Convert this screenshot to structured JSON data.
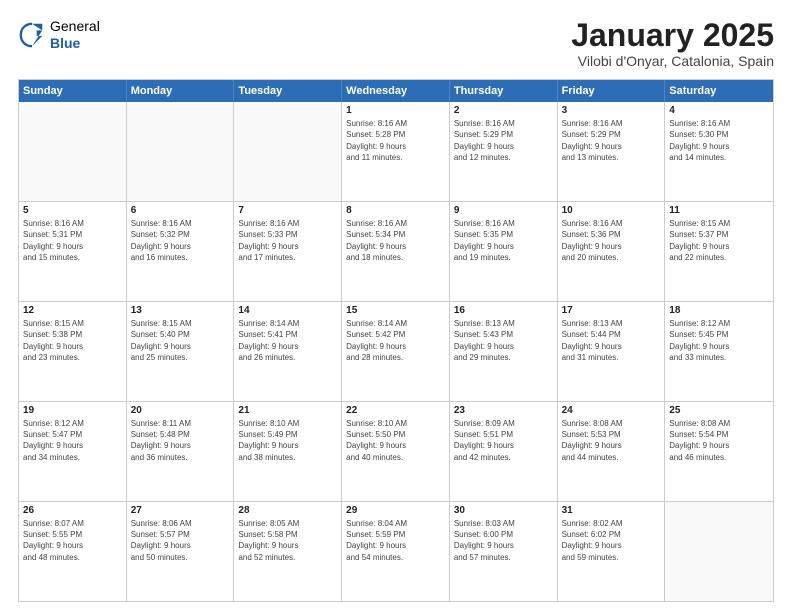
{
  "header": {
    "logo_general": "General",
    "logo_blue": "Blue",
    "month_year": "January 2025",
    "location": "Vilobi d'Onyar, Catalonia, Spain"
  },
  "weekdays": [
    "Sunday",
    "Monday",
    "Tuesday",
    "Wednesday",
    "Thursday",
    "Friday",
    "Saturday"
  ],
  "weeks": [
    [
      {
        "day": "",
        "info": ""
      },
      {
        "day": "",
        "info": ""
      },
      {
        "day": "",
        "info": ""
      },
      {
        "day": "1",
        "info": "Sunrise: 8:16 AM\nSunset: 5:28 PM\nDaylight: 9 hours\nand 11 minutes."
      },
      {
        "day": "2",
        "info": "Sunrise: 8:16 AM\nSunset: 5:29 PM\nDaylight: 9 hours\nand 12 minutes."
      },
      {
        "day": "3",
        "info": "Sunrise: 8:16 AM\nSunset: 5:29 PM\nDaylight: 9 hours\nand 13 minutes."
      },
      {
        "day": "4",
        "info": "Sunrise: 8:16 AM\nSunset: 5:30 PM\nDaylight: 9 hours\nand 14 minutes."
      }
    ],
    [
      {
        "day": "5",
        "info": "Sunrise: 8:16 AM\nSunset: 5:31 PM\nDaylight: 9 hours\nand 15 minutes."
      },
      {
        "day": "6",
        "info": "Sunrise: 8:16 AM\nSunset: 5:32 PM\nDaylight: 9 hours\nand 16 minutes."
      },
      {
        "day": "7",
        "info": "Sunrise: 8:16 AM\nSunset: 5:33 PM\nDaylight: 9 hours\nand 17 minutes."
      },
      {
        "day": "8",
        "info": "Sunrise: 8:16 AM\nSunset: 5:34 PM\nDaylight: 9 hours\nand 18 minutes."
      },
      {
        "day": "9",
        "info": "Sunrise: 8:16 AM\nSunset: 5:35 PM\nDaylight: 9 hours\nand 19 minutes."
      },
      {
        "day": "10",
        "info": "Sunrise: 8:16 AM\nSunset: 5:36 PM\nDaylight: 9 hours\nand 20 minutes."
      },
      {
        "day": "11",
        "info": "Sunrise: 8:15 AM\nSunset: 5:37 PM\nDaylight: 9 hours\nand 22 minutes."
      }
    ],
    [
      {
        "day": "12",
        "info": "Sunrise: 8:15 AM\nSunset: 5:38 PM\nDaylight: 9 hours\nand 23 minutes."
      },
      {
        "day": "13",
        "info": "Sunrise: 8:15 AM\nSunset: 5:40 PM\nDaylight: 9 hours\nand 25 minutes."
      },
      {
        "day": "14",
        "info": "Sunrise: 8:14 AM\nSunset: 5:41 PM\nDaylight: 9 hours\nand 26 minutes."
      },
      {
        "day": "15",
        "info": "Sunrise: 8:14 AM\nSunset: 5:42 PM\nDaylight: 9 hours\nand 28 minutes."
      },
      {
        "day": "16",
        "info": "Sunrise: 8:13 AM\nSunset: 5:43 PM\nDaylight: 9 hours\nand 29 minutes."
      },
      {
        "day": "17",
        "info": "Sunrise: 8:13 AM\nSunset: 5:44 PM\nDaylight: 9 hours\nand 31 minutes."
      },
      {
        "day": "18",
        "info": "Sunrise: 8:12 AM\nSunset: 5:45 PM\nDaylight: 9 hours\nand 33 minutes."
      }
    ],
    [
      {
        "day": "19",
        "info": "Sunrise: 8:12 AM\nSunset: 5:47 PM\nDaylight: 9 hours\nand 34 minutes."
      },
      {
        "day": "20",
        "info": "Sunrise: 8:11 AM\nSunset: 5:48 PM\nDaylight: 9 hours\nand 36 minutes."
      },
      {
        "day": "21",
        "info": "Sunrise: 8:10 AM\nSunset: 5:49 PM\nDaylight: 9 hours\nand 38 minutes."
      },
      {
        "day": "22",
        "info": "Sunrise: 8:10 AM\nSunset: 5:50 PM\nDaylight: 9 hours\nand 40 minutes."
      },
      {
        "day": "23",
        "info": "Sunrise: 8:09 AM\nSunset: 5:51 PM\nDaylight: 9 hours\nand 42 minutes."
      },
      {
        "day": "24",
        "info": "Sunrise: 8:08 AM\nSunset: 5:53 PM\nDaylight: 9 hours\nand 44 minutes."
      },
      {
        "day": "25",
        "info": "Sunrise: 8:08 AM\nSunset: 5:54 PM\nDaylight: 9 hours\nand 46 minutes."
      }
    ],
    [
      {
        "day": "26",
        "info": "Sunrise: 8:07 AM\nSunset: 5:55 PM\nDaylight: 9 hours\nand 48 minutes."
      },
      {
        "day": "27",
        "info": "Sunrise: 8:06 AM\nSunset: 5:57 PM\nDaylight: 9 hours\nand 50 minutes."
      },
      {
        "day": "28",
        "info": "Sunrise: 8:05 AM\nSunset: 5:58 PM\nDaylight: 9 hours\nand 52 minutes."
      },
      {
        "day": "29",
        "info": "Sunrise: 8:04 AM\nSunset: 5:59 PM\nDaylight: 9 hours\nand 54 minutes."
      },
      {
        "day": "30",
        "info": "Sunrise: 8:03 AM\nSunset: 6:00 PM\nDaylight: 9 hours\nand 57 minutes."
      },
      {
        "day": "31",
        "info": "Sunrise: 8:02 AM\nSunset: 6:02 PM\nDaylight: 9 hours\nand 59 minutes."
      },
      {
        "day": "",
        "info": ""
      }
    ]
  ]
}
